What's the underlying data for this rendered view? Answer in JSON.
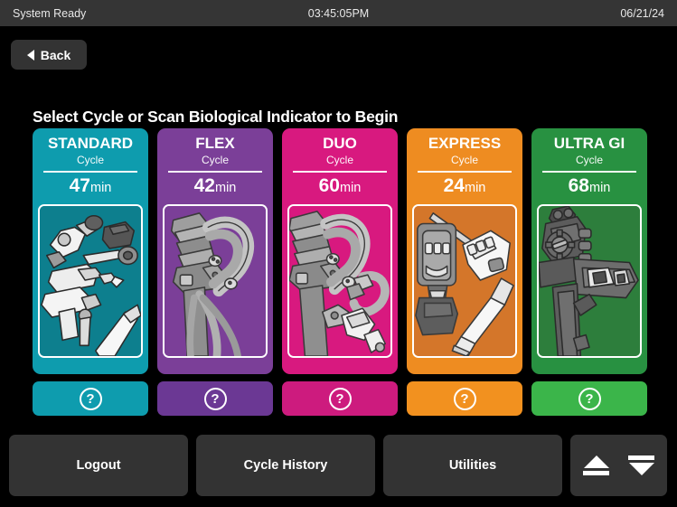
{
  "statusbar": {
    "system_status": "System Ready",
    "time": "03:45:05PM",
    "date": "06/21/24"
  },
  "nav": {
    "back_label": "Back",
    "back_icon": "triangle-left-icon"
  },
  "main": {
    "heading": "Select Cycle or Scan Biological Indicator to Begin",
    "cycles": [
      {
        "name": "STANDARD",
        "subtitle": "Cycle",
        "duration": "47",
        "duration_unit": "min",
        "color": "#0e9cae",
        "help_color": "#0e9cae",
        "help_icon": "question-mark-icon",
        "art": "rigid-scopes-and-handpieces-illustration"
      },
      {
        "name": "FLEX",
        "subtitle": "Cycle",
        "duration": "42",
        "duration_unit": "min",
        "color": "#7b3f98",
        "help_color": "#6b3894",
        "help_icon": "question-mark-icon",
        "art": "flexible-endoscope-illustration"
      },
      {
        "name": "DUO",
        "subtitle": "Cycle",
        "duration": "60",
        "duration_unit": "min",
        "color": "#d8197f",
        "help_color": "#cd1b7e",
        "help_icon": "question-mark-icon",
        "art": "duodenoscope-and-handpiece-illustration"
      },
      {
        "name": "EXPRESS",
        "subtitle": "Cycle",
        "duration": "24",
        "duration_unit": "min",
        "color": "#ee8c21",
        "help_color": "#f2911f",
        "help_icon": "question-mark-icon",
        "art": "battery-handpiece-and-ultrasound-probe-illustration"
      },
      {
        "name": "ULTRA GI",
        "subtitle": "Cycle",
        "duration": "68",
        "duration_unit": "min",
        "color": "#289141",
        "help_color": "#3bb54a",
        "help_icon": "question-mark-icon",
        "art": "duodenoscope-control-body-illustration"
      }
    ]
  },
  "toolbar": {
    "logout_label": "Logout",
    "cycle_history_label": "Cycle History",
    "utilities_label": "Utilities",
    "raise_icon": "eject-up-icon",
    "lower_icon": "lower-down-icon"
  },
  "theme": {
    "background": "#000000",
    "statusbar_bg": "#353535",
    "button_bg": "#333333",
    "text": "#ffffff"
  }
}
